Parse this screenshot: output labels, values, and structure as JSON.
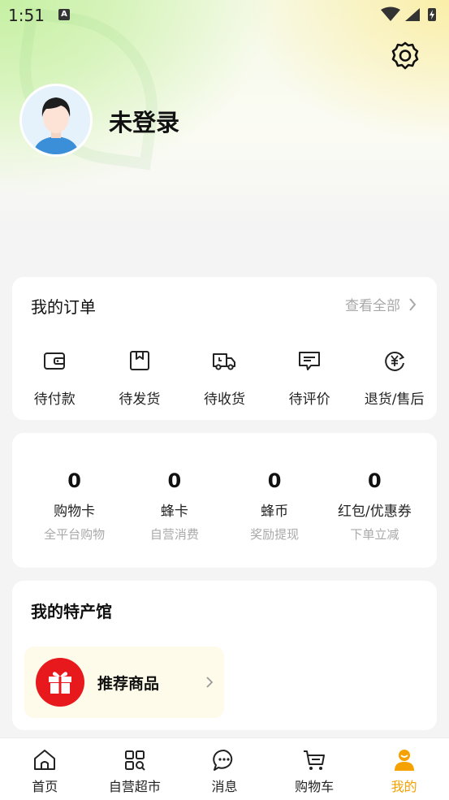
{
  "status_bar": {
    "time": "1:51",
    "notification_badge": "A"
  },
  "header": {
    "settings_icon": "gear-icon",
    "username": "未登录"
  },
  "orders": {
    "title": "我的订单",
    "view_all": "查看全部",
    "items": [
      {
        "label": "待付款",
        "icon": "wallet-icon"
      },
      {
        "label": "待发货",
        "icon": "package-icon"
      },
      {
        "label": "待收货",
        "icon": "truck-icon"
      },
      {
        "label": "待评价",
        "icon": "comment-icon"
      },
      {
        "label": "退货/售后",
        "icon": "refund-icon"
      }
    ]
  },
  "assets": {
    "items": [
      {
        "value": "0",
        "name": "购物卡",
        "sub": "全平台购物"
      },
      {
        "value": "0",
        "name": "蜂卡",
        "sub": "自营消费"
      },
      {
        "value": "0",
        "name": "蜂币",
        "sub": "奖励提现"
      },
      {
        "value": "0",
        "name": "红包/优惠券",
        "sub": "下单立减"
      }
    ]
  },
  "specialty": {
    "title": "我的特产馆",
    "recommend_label": "推荐商品",
    "recommend_icon": "gift-icon"
  },
  "tabbar": {
    "items": [
      {
        "label": "首页",
        "icon": "home-icon",
        "active": false
      },
      {
        "label": "自营超市",
        "icon": "grid-search-icon",
        "active": false
      },
      {
        "label": "消息",
        "icon": "message-icon",
        "active": false
      },
      {
        "label": "购物车",
        "icon": "cart-icon",
        "active": false
      },
      {
        "label": "我的",
        "icon": "profile-icon",
        "active": true
      }
    ]
  },
  "colors": {
    "accent": "#f5a100",
    "gift_red": "#e8191c",
    "background": "#f4f4f4"
  }
}
